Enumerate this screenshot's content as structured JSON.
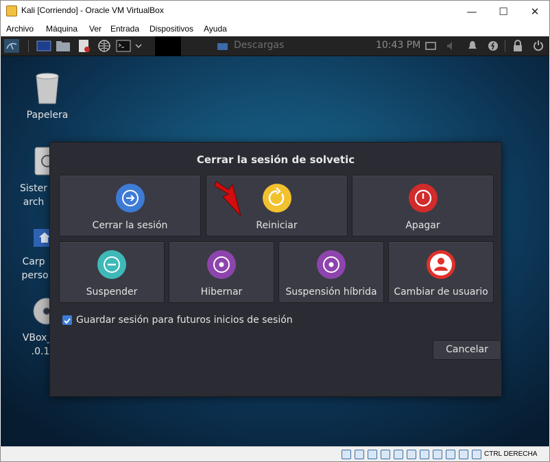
{
  "window": {
    "title": "Kali [Corriendo] - Oracle VM VirtualBox",
    "controls": {
      "minimize": "—",
      "maximize": "☐",
      "close": "✕"
    }
  },
  "menu": {
    "items": [
      "Archivo",
      "Máquina",
      "Ver",
      "Entrada",
      "Dispositivos",
      "Ayuda"
    ]
  },
  "panel": {
    "task_label": "Descargas",
    "clock": "10:43 PM"
  },
  "desktop": {
    "icons": [
      {
        "label": "Papelera"
      },
      {
        "label": "Sister",
        "label2": "arch"
      },
      {
        "label": "Carp",
        "label2": "perso"
      },
      {
        "label": "VBox_C",
        "label2": ".0.1"
      }
    ]
  },
  "dialog": {
    "heading": "Cerrar la sesión de solvetic",
    "actions": [
      {
        "label": "Cerrar la sesión",
        "icon": "logout-icon",
        "color": "#3d7bd6"
      },
      {
        "label": "Reiniciar",
        "icon": "restart-icon",
        "color": "#f2c12e"
      },
      {
        "label": "Apagar",
        "icon": "power-icon",
        "color": "#d12b2b"
      },
      {
        "label": "Suspender",
        "icon": "suspend-icon",
        "color": "#3fb8b8"
      },
      {
        "label": "Hibernar",
        "icon": "hibernate-icon",
        "color": "#8e44ad"
      },
      {
        "label": "Suspensión híbrida",
        "icon": "hybrid-sleep-icon",
        "color": "#8e44ad"
      },
      {
        "label": "Cambiar de usuario",
        "icon": "switch-user-icon",
        "color": "#e0302a"
      }
    ],
    "save_session": {
      "checked": true,
      "label": "Guardar sesión para futuros inicios de sesión"
    },
    "cancel_label": "Cancelar"
  },
  "statusbar": {
    "host_key": "CTRL DERECHA"
  }
}
